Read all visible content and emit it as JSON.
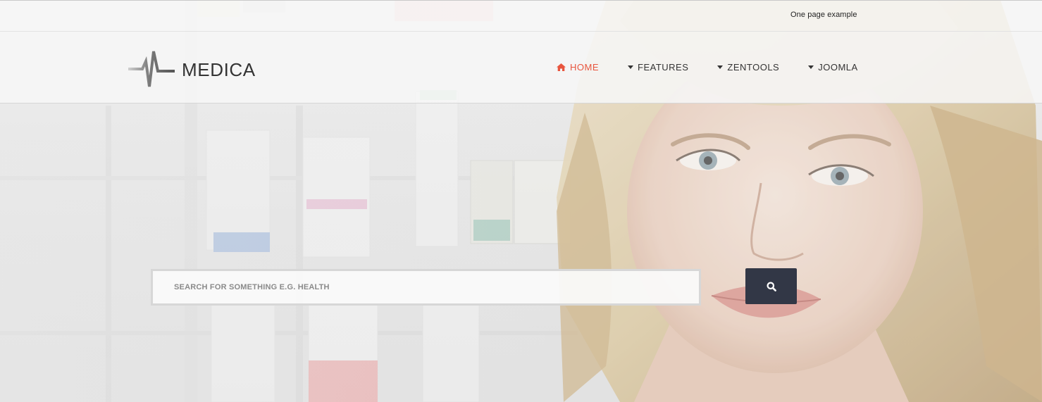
{
  "top_bar": {
    "link_label": "One page example"
  },
  "header": {
    "logo_text": "MEDICA",
    "nav": [
      {
        "label": "HOME",
        "icon": "home-icon",
        "active": true
      },
      {
        "label": "FEATURES",
        "icon": "caret-down-icon",
        "active": false
      },
      {
        "label": "ZENTOOLS",
        "icon": "caret-down-icon",
        "active": false
      },
      {
        "label": "JOOMLA",
        "icon": "caret-down-icon",
        "active": false
      }
    ]
  },
  "search": {
    "placeholder": "SEARCH FOR SOMETHING E.G. HEALTH",
    "value": "",
    "button_icon": "search-icon"
  },
  "colors": {
    "accent": "#e8553e",
    "button": "#323746",
    "nav_text": "#333333"
  }
}
